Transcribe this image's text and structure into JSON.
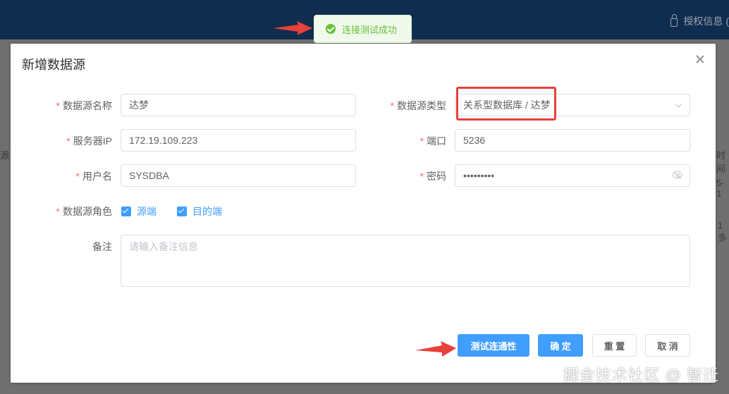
{
  "topbar": {
    "auth_label": "授权信息 ("
  },
  "background_fragments": {
    "a": "源",
    "b": "时间",
    "c": "5-1",
    "d": "1 多"
  },
  "toast": {
    "message": "连接测试成功",
    "type": "success",
    "color": "#67c23a"
  },
  "dialog": {
    "title": "新增数据源",
    "fields": {
      "name": {
        "label": "数据源名称",
        "value": "达梦"
      },
      "type": {
        "label": "数据源类型",
        "value": "关系型数据库 / 达梦"
      },
      "ip": {
        "label": "服务器IP",
        "value": "172.19.109.223"
      },
      "port": {
        "label": "端口",
        "value": "5236"
      },
      "user": {
        "label": "用户名",
        "value": "SYSDBA"
      },
      "password": {
        "label": "密码",
        "value": "•••••••••"
      },
      "role": {
        "label": "数据源角色",
        "options": [
          "源端",
          "目的端"
        ],
        "checked": [
          true,
          true
        ]
      },
      "remark": {
        "label": "备注",
        "placeholder": "请输入备注信息"
      }
    },
    "buttons": {
      "test": "测试连通性",
      "confirm": "确 定",
      "reset": "重 置",
      "cancel": "取 消"
    }
  },
  "colors": {
    "primary": "#409eff",
    "required": "#f56c6c",
    "annotation": "#e8403a",
    "header": "#0f2d4f"
  },
  "watermark": "掘金技术社区 @ 智迁"
}
